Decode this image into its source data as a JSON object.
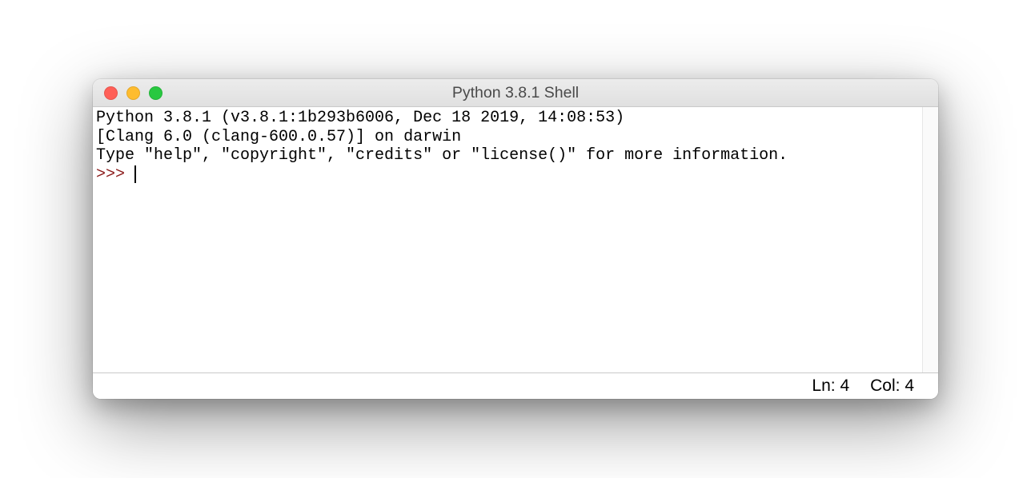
{
  "window": {
    "title": "Python 3.8.1 Shell"
  },
  "shell": {
    "line1": "Python 3.8.1 (v3.8.1:1b293b6006, Dec 18 2019, 14:08:53) ",
    "line2": "[Clang 6.0 (clang-600.0.57)] on darwin",
    "line3": "Type \"help\", \"copyright\", \"credits\" or \"license()\" for more information.",
    "prompt": ">>> "
  },
  "statusbar": {
    "line_label": "Ln: 4",
    "col_label": "Col: 4"
  }
}
